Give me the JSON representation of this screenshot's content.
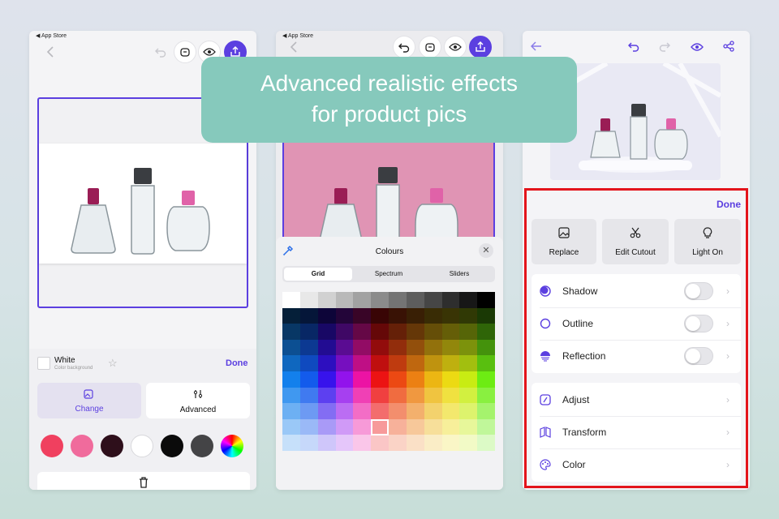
{
  "banner": {
    "line1": "Advanced realistic effects",
    "line2": "for product pics"
  },
  "phone1": {
    "status_back": "◀ App Store",
    "bg_name": "White",
    "bg_sub": "Color background",
    "done": "Done",
    "change": "Change",
    "advanced": "Advanced",
    "swatches": [
      "#f0405f",
      "#f06b9c",
      "#2e0f1b",
      "#ffffff",
      "#0b0b0b",
      "#444446",
      "rainbow"
    ]
  },
  "phone2": {
    "status_back": "◀ App Store",
    "colours_title": "Colours",
    "tabs": [
      "Grid",
      "Spectrum",
      "Sliders"
    ],
    "selected_colour": "#f2a6c6",
    "presets": [
      "#0b0b0b",
      "#1e6ef0",
      "#2db34a",
      "#f5c40c",
      "#ee3a2c"
    ]
  },
  "phone3": {
    "done": "Done",
    "tools": [
      "Replace",
      "Edit Cutout",
      "Light On"
    ],
    "effects": [
      "Shadow",
      "Outline",
      "Reflection"
    ],
    "adjust_items": [
      "Adjust",
      "Transform",
      "Color"
    ],
    "accent": "#5b3fe0",
    "highlight": "#e3141b"
  }
}
